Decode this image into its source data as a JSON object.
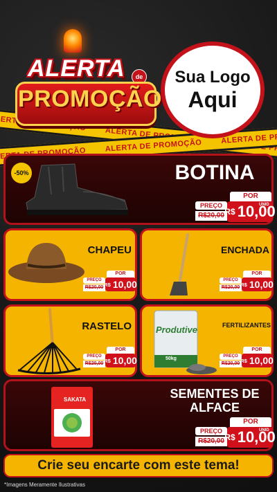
{
  "header": {
    "alerta": "ALERTA",
    "de": "de",
    "promocao": "PROMOÇÃO",
    "logo_line1": "Sua Logo",
    "logo_line2": "Aqui"
  },
  "tape_text": "ALERTA DE PROMOÇÃO",
  "sale_badge": "-50%",
  "products": {
    "botina": {
      "name": "BOTINA",
      "por": "POR",
      "preco": "PREÇO",
      "old_price": "R$20,00",
      "rs": "R$",
      "price": "10,00",
      "unid": "UNID"
    },
    "chapeu": {
      "name": "CHAPEU",
      "por": "POR",
      "preco": "PREÇO",
      "old_price": "R$20,00",
      "rs": "R$",
      "price": "10,00"
    },
    "enchada": {
      "name": "ENCHADA",
      "por": "POR",
      "preco": "PREÇO",
      "old_price": "R$20,00",
      "rs": "R$",
      "price": "10,00"
    },
    "rastelo": {
      "name": "RASTELO",
      "por": "POR",
      "preco": "PREÇO",
      "old_price": "R$20,00",
      "rs": "R$",
      "price": "10,00"
    },
    "fertilizantes": {
      "name": "FERTILIZANTES",
      "por": "POR",
      "preco": "PREÇO",
      "old_price": "R$20,00",
      "rs": "R$",
      "price": "10,00",
      "bag_brand": "Produtive",
      "bag_weight": "50kg"
    },
    "sementes": {
      "name_line1": "SEMENTES DE",
      "name_line2": "ALFACE",
      "por": "POR",
      "preco": "PREÇO",
      "old_price": "R$20,00",
      "rs": "R$",
      "price": "10,00",
      "unid": "UNID",
      "pack_brand": "SAKATA"
    }
  },
  "cta": "Crie seu encarte com este tema!",
  "footnote": "*Imagens Meramente Ilustrativas",
  "colors": {
    "red": "#c4121a",
    "yellow": "#f5b400",
    "dark": "#1b1b1b"
  }
}
